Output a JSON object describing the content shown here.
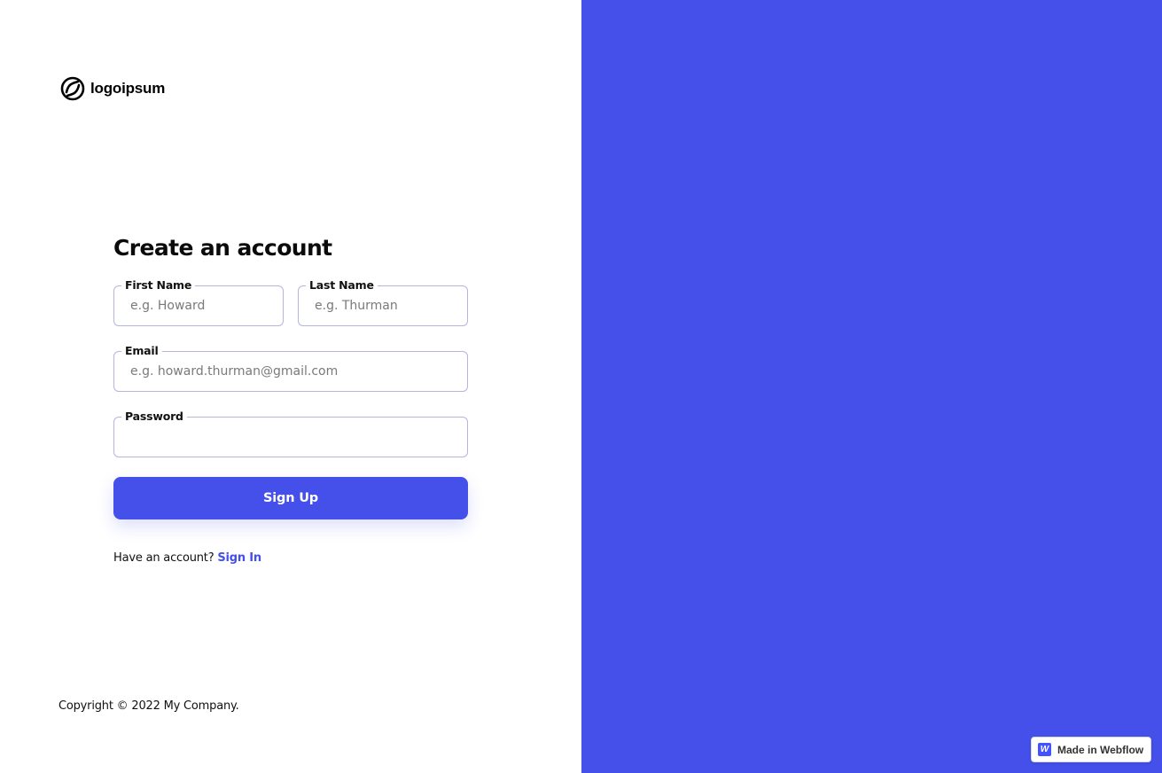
{
  "brand": {
    "logo_text": "logoipsum",
    "accent_color": "#4450e9"
  },
  "form": {
    "title": "Create an account",
    "fields": {
      "first_name": {
        "label": "First Name",
        "placeholder": "e.g. Howard",
        "value": ""
      },
      "last_name": {
        "label": "Last Name",
        "placeholder": "e.g. Thurman",
        "value": ""
      },
      "email": {
        "label": "Email",
        "placeholder": "e.g. howard.thurman@gmail.com",
        "value": ""
      },
      "password": {
        "label": "Password",
        "placeholder": "",
        "value": ""
      }
    },
    "submit_label": "Sign Up",
    "have_account_text": "Have an account?",
    "signin_label": "Sign In"
  },
  "footer": {
    "copyright": "Copyright © 2022 My Company."
  },
  "badge": {
    "icon_letter": "W",
    "label": "Made in Webflow"
  }
}
